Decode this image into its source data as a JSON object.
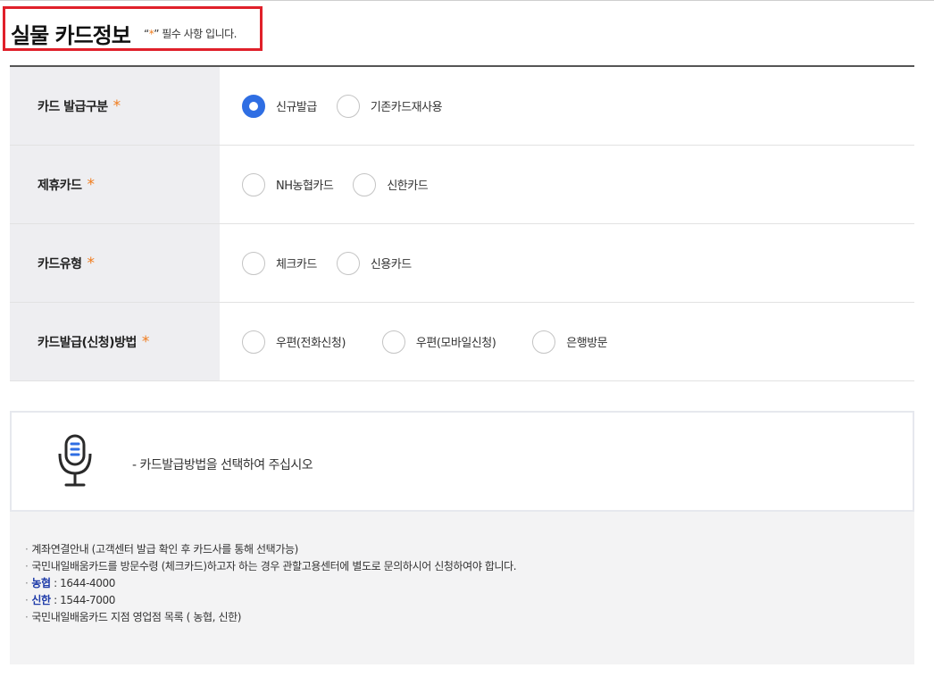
{
  "section": {
    "title": "실물 카드정보",
    "required_note_prefix": "“",
    "required_star": "*",
    "required_note_suffix": "” 필수 사항 입니다.",
    "highlight_color": "#e0202a"
  },
  "form": {
    "rows": [
      {
        "label": "카드 발급구분",
        "star": "*",
        "options": [
          {
            "label": "신규발급",
            "checked": true
          },
          {
            "label": "기존카드재사용",
            "checked": false
          }
        ]
      },
      {
        "label": "제휴카드",
        "star": "*",
        "options": [
          {
            "label": "NH농협카드",
            "checked": false
          },
          {
            "label": "신한카드",
            "checked": false
          }
        ]
      },
      {
        "label": "카드유형",
        "star": "*",
        "options": [
          {
            "label": "체크카드",
            "checked": false
          },
          {
            "label": "신용카드",
            "checked": false
          }
        ]
      },
      {
        "label": "카드발급(신청)방법",
        "star": "*",
        "options": [
          {
            "label": "우편(전화신청)",
            "checked": false
          },
          {
            "label": "우편(모바일신청)",
            "checked": false
          },
          {
            "label": "은행방문",
            "checked": false
          }
        ]
      }
    ]
  },
  "voice": {
    "icon": "microphone-icon",
    "message": "- 카드발급방법을 선택하여 주십시오"
  },
  "info": {
    "bullet": "·",
    "line1": "계좌연결안내 (고객센터 발급 확인 후 카드사를 통해 선택가능)",
    "line2": "국민내일배움카드를 방문수령 (체크카드)하고자 하는 경우 관할고용센터에 별도로 문의하시어 신청하여야 합니다.",
    "nh_label": "농협",
    "nh_phone": " : 1644-4000",
    "shinhan_label": "신한",
    "shinhan_phone": " : 1544-7000",
    "line5": "국민내일배움카드 지점 영업점 목록 ( 농협, 신한)"
  },
  "colors": {
    "accent_blue": "#2f6ee3",
    "star_orange": "#f07b1c"
  }
}
